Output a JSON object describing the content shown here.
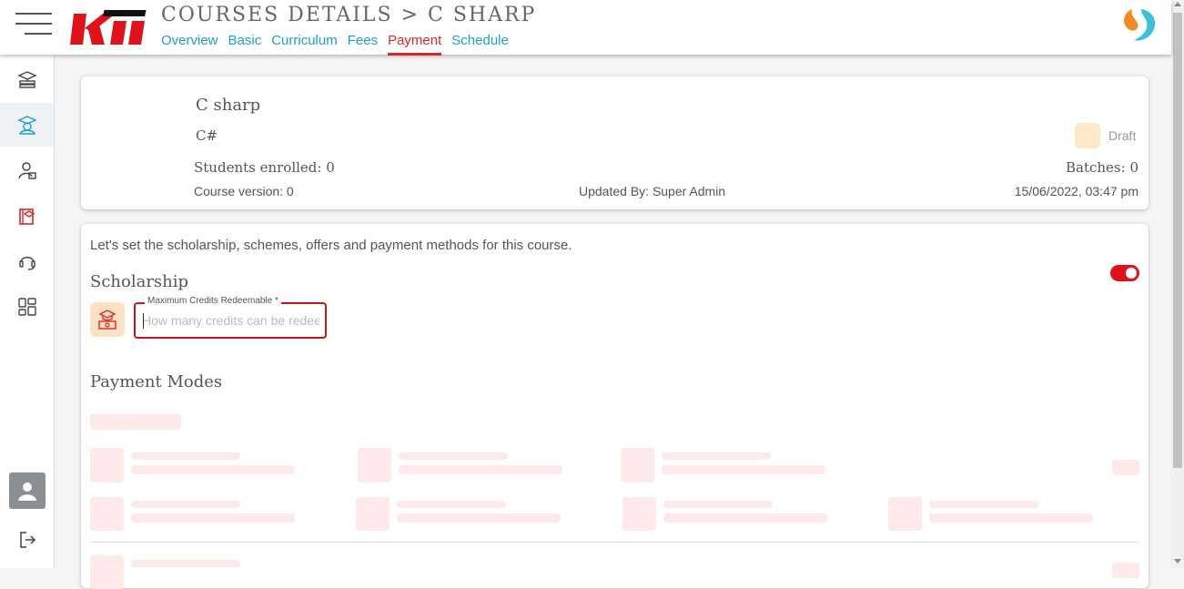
{
  "header": {
    "title": "COURSES DETAILS > C SHARP",
    "tabs": [
      {
        "label": "Overview",
        "active": false
      },
      {
        "label": "Basic",
        "active": false
      },
      {
        "label": "Curriculum",
        "active": false
      },
      {
        "label": "Fees",
        "active": false
      },
      {
        "label": "Payment",
        "active": true
      },
      {
        "label": "Schedule",
        "active": false
      }
    ]
  },
  "sidebar": {
    "items": [
      {
        "icon": "books-stack-icon"
      },
      {
        "icon": "graduate-user-icon",
        "active": true
      },
      {
        "icon": "user-card-icon"
      },
      {
        "icon": "course-book-icon"
      },
      {
        "icon": "headset-icon"
      },
      {
        "icon": "dashboard-grid-icon"
      }
    ],
    "bottom": [
      {
        "icon": "avatar-icon"
      },
      {
        "icon": "logout-icon"
      }
    ]
  },
  "course": {
    "name": "C sharp",
    "code": "C#",
    "students_enrolled": "Students enrolled: 0",
    "course_version": "Course version: 0",
    "updated_by": "Updated By: Super Admin",
    "updated_at": "15/06/2022, 03:47 pm",
    "batches": "Batches: 0",
    "status": "Draft"
  },
  "payment": {
    "intro": "Let's set the scholarship, schemes, offers and payment methods for this course.",
    "scholarship_title": "Scholarship",
    "scholarship_enabled": true,
    "credits_label": "Maximum Credits Redeemable *",
    "credits_placeholder": "How many credits can be redeemed",
    "credits_value": "",
    "payment_modes_title": "Payment Modes"
  },
  "colors": {
    "accent_red": "#d9272b",
    "link_blue": "#1a9fd0",
    "skeleton": "#fde9ea",
    "draft_badge": "#fde8c8"
  }
}
